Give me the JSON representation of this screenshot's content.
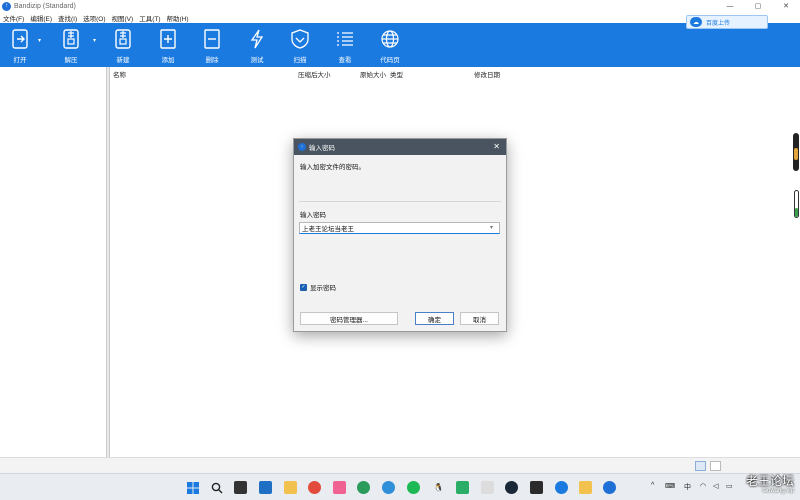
{
  "window": {
    "title": "Bandizip (Standard)"
  },
  "menu": [
    "文件(F)",
    "编辑(E)",
    "查找(I)",
    "选项(O)",
    "视图(V)",
    "工具(T)",
    "帮助(H)"
  ],
  "toolbar": {
    "accent": "#1a7ae0",
    "items": [
      {
        "label": "打开",
        "icon": "open-icon"
      },
      {
        "label": "解压",
        "icon": "extract-icon"
      },
      {
        "label": "新建",
        "icon": "new-archive-icon"
      },
      {
        "label": "添加",
        "icon": "add-icon"
      },
      {
        "label": "删除",
        "icon": "delete-icon"
      },
      {
        "label": "测试",
        "icon": "test-icon"
      },
      {
        "label": "扫描",
        "icon": "scan-icon"
      },
      {
        "label": "查看",
        "icon": "view-icon"
      },
      {
        "label": "代码页",
        "icon": "codepage-icon"
      }
    ],
    "cloud_upload": "百度上传"
  },
  "file_list": {
    "columns": [
      "名称",
      "压缩后大小",
      "原始大小",
      "类型",
      "修改日期"
    ]
  },
  "dialog": {
    "title": "输入密码",
    "prompt": "输入加密文件的密码。",
    "password_label": "输入密码",
    "password_value": "上老王论坛当老王",
    "show_password_label": "显示密码",
    "show_password_checked": true,
    "password_manager_button": "密码管理器...",
    "ok_button": "确定",
    "cancel_button": "取消"
  },
  "taskbar": {
    "tray": {
      "ime": "中"
    }
  },
  "watermark": {
    "title": "老王论坛",
    "url": "laowang.vip"
  }
}
